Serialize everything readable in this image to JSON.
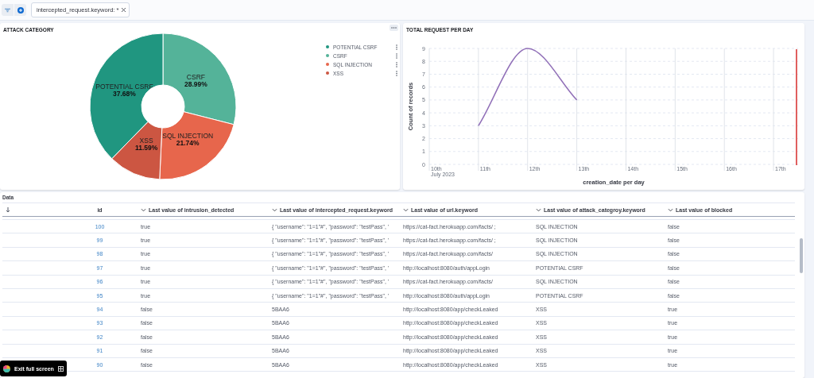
{
  "filter_bar": {
    "chip": "intercepted_request.keyword: *"
  },
  "attack_panel": {
    "title": "ATTACK CATEGORY",
    "chart_data": {
      "type": "donut",
      "categories": [
        "CSRF",
        "SQL INJECTION",
        "XSS",
        "POTENTIAL CSRF"
      ],
      "values": [
        28.99,
        21.74,
        11.59,
        37.68
      ],
      "value_labels": [
        "28.99%",
        "21.74%",
        "11.59%",
        "37.68%"
      ],
      "colors": [
        "#54b399",
        "#e7664c",
        "#cc5642",
        "#209680"
      ]
    },
    "legend": [
      {
        "label": "POTENTIAL CSRF",
        "color": "#209680"
      },
      {
        "label": "CSRF",
        "color": "#54b399"
      },
      {
        "label": "SQL INJECTION",
        "color": "#e7664c"
      },
      {
        "label": "XSS",
        "color": "#cc5642"
      }
    ]
  },
  "request_panel": {
    "title": "TOTAL REQUEST PER DAY",
    "date_caption": "July 2023",
    "chart_data": {
      "type": "line",
      "xlabel": "creation_date per day",
      "ylabel": "Count of records",
      "categories": [
        "10th",
        "11th",
        "12th",
        "13th",
        "14th",
        "15th",
        "16th",
        "17th"
      ],
      "series": [
        {
          "color": "#9170b8",
          "values": [
            null,
            3,
            9,
            5,
            null,
            null,
            null,
            null
          ]
        }
      ],
      "ylim": [
        0,
        9
      ],
      "yticks": [
        0,
        1,
        2,
        3,
        4,
        5,
        6,
        7,
        8,
        9
      ],
      "grid": true
    }
  },
  "table": {
    "title": "Data",
    "columns": [
      "id",
      "Last value of intrusion_detected",
      "Last value of intercepted_request.keyword",
      "Last value of url.keyword",
      "Last value of attack_categroy.keyword",
      "Last value of blocked"
    ],
    "rows": [
      [
        "100",
        "true",
        "{ \"username\": \"1=1\"#\", \"password\": \"testPass\", '",
        "https://cat-fact.herokuapp.com/facts/ ;",
        "SQL INJECTION",
        "false"
      ],
      [
        "99",
        "true",
        "{ \"username\": \"1=1\"#\", \"password\": \"testPass\", '",
        "https://cat-fact.herokuapp.com/facts/ ;",
        "SQL INJECTION",
        "false"
      ],
      [
        "98",
        "true",
        "{ \"username\": \"1=1\"#\", \"password\": \"testPass\", '",
        "https://cat-fact.herokuapp.com/facts/",
        "SQL INJECTION",
        "false"
      ],
      [
        "97",
        "true",
        "{ \"username\": \"1=1\"#\", \"password\": \"testPass\", '",
        "http://localhost:8080/auth/appLogin",
        "POTENTIAL CSRF",
        "false"
      ],
      [
        "96",
        "true",
        "{ \"username\": \"1=1\"#\", \"password\": \"testPass\", '",
        "https://cat-fact.herokuapp.com/facts/",
        "SQL INJECTION",
        "false"
      ],
      [
        "95",
        "true",
        "{ \"username\": \"1=1\"#\", \"password\": \"testPass\", '",
        "http://localhost:8080/auth/appLogin",
        "POTENTIAL CSRF",
        "false"
      ],
      [
        "94",
        "false",
        "5BAA6",
        "http://localhost:8080/app/checkLeaked",
        "XSS",
        "true"
      ],
      [
        "93",
        "false",
        "5BAA6",
        "http://localhost:8080/app/checkLeaked",
        "XSS",
        "true"
      ],
      [
        "92",
        "false",
        "5BAA6",
        "http://localhost:8080/app/checkLeaked",
        "XSS",
        "true"
      ],
      [
        "91",
        "false",
        "5BAA6",
        "http://localhost:8080/app/checkLeaked",
        "XSS",
        "true"
      ],
      [
        "90",
        "false",
        "5BAA6",
        "http://localhost:8080/app/checkLeaked",
        "XSS",
        "true"
      ]
    ]
  },
  "exit_button": {
    "label": "Exit full screen"
  }
}
